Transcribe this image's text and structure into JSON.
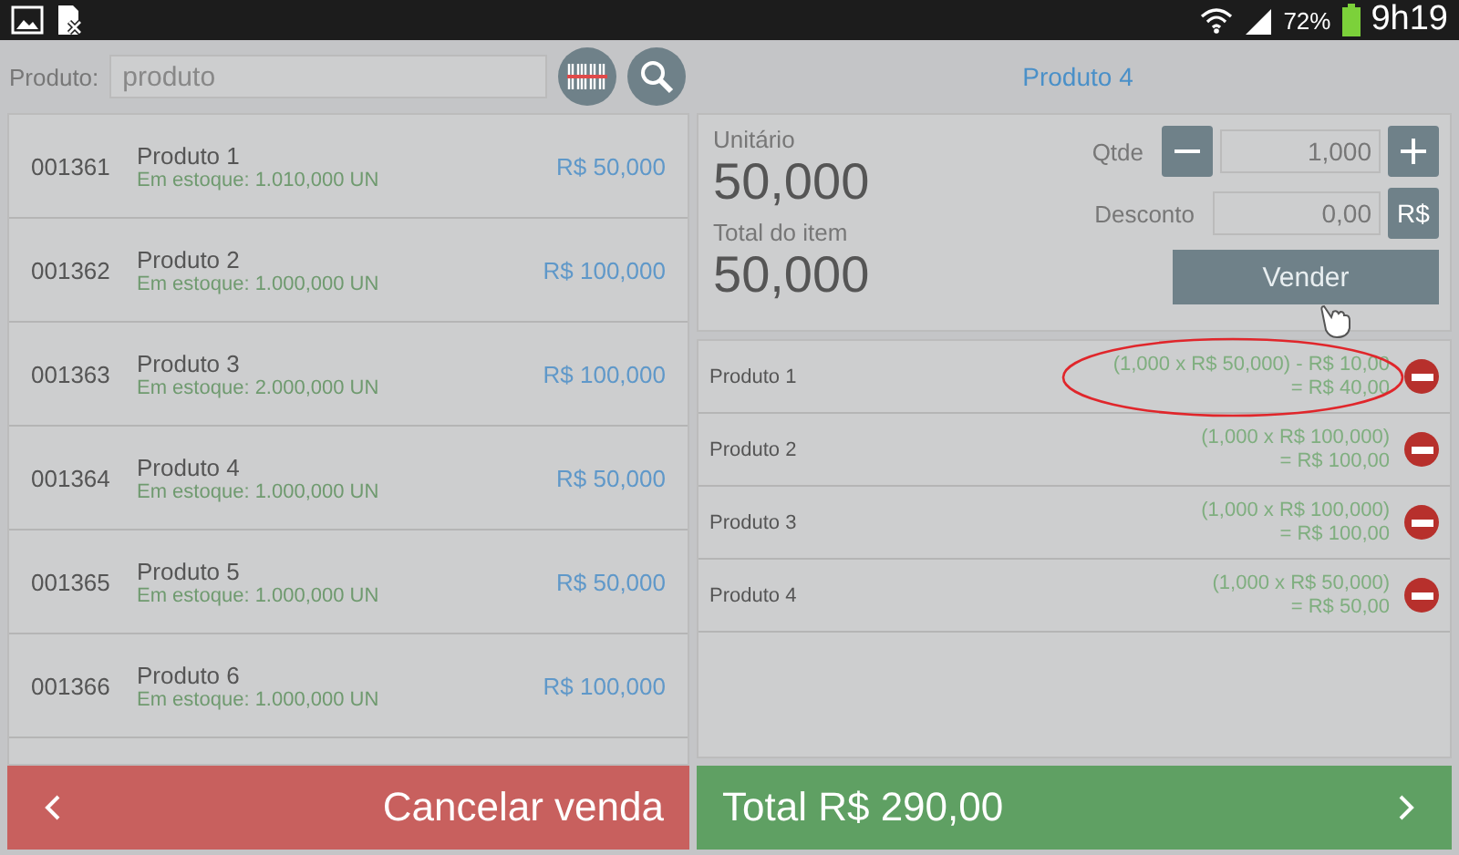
{
  "status_bar": {
    "battery_text": "72%",
    "time": "9h19"
  },
  "search": {
    "label": "Produto:",
    "placeholder": "produto"
  },
  "selected_product": {
    "title": "Produto 4",
    "unit_label": "Unitário",
    "unit_value": "50,000",
    "total_label": "Total do item",
    "total_value": "50,000",
    "qty_label": "Qtde",
    "qty_value": "1,000",
    "discount_label": "Desconto",
    "discount_value": "0,00",
    "discount_unit": "R$",
    "sell_button": "Vender"
  },
  "products": [
    {
      "code": "001361",
      "name": "Produto 1",
      "stock": "Em estoque: 1.010,000 UN",
      "price": "R$ 50,000"
    },
    {
      "code": "001362",
      "name": "Produto 2",
      "stock": "Em estoque: 1.000,000 UN",
      "price": "R$ 100,000"
    },
    {
      "code": "001363",
      "name": "Produto 3",
      "stock": "Em estoque: 2.000,000 UN",
      "price": "R$ 100,000"
    },
    {
      "code": "001364",
      "name": "Produto 4",
      "stock": "Em estoque: 1.000,000 UN",
      "price": "R$ 50,000"
    },
    {
      "code": "001365",
      "name": "Produto 5",
      "stock": "Em estoque: 1.000,000 UN",
      "price": "R$ 50,000"
    },
    {
      "code": "001366",
      "name": "Produto 6",
      "stock": "Em estoque: 1.000,000 UN",
      "price": "R$ 100,000"
    }
  ],
  "cart": [
    {
      "name": "Produto 1",
      "calc": "(1,000 x R$ 50,000) - R$ 10,00",
      "total": "= R$ 40,00",
      "annotated": true
    },
    {
      "name": "Produto 2",
      "calc": "(1,000 x R$ 100,000)",
      "total": "= R$ 100,00",
      "annotated": false
    },
    {
      "name": "Produto 3",
      "calc": "(1,000 x R$ 100,000)",
      "total": "= R$ 100,00",
      "annotated": false
    },
    {
      "name": "Produto 4",
      "calc": "(1,000 x R$ 50,000)",
      "total": "= R$ 50,00",
      "annotated": false
    }
  ],
  "footer": {
    "cancel": "Cancelar venda",
    "total": "Total R$ 290,00"
  }
}
